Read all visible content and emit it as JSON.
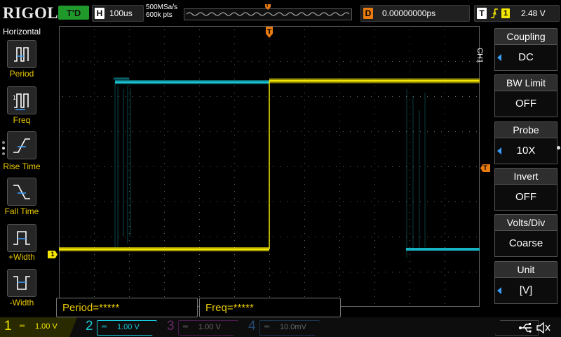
{
  "brand": {
    "logo": "RIGOL"
  },
  "top": {
    "status": "T'D",
    "timebase_tag": "H",
    "timebase": "100us",
    "sample_rate": "500MSa/s",
    "mem_depth": "600k pts",
    "trigger_pos_marker": "T",
    "delay_tag": "D",
    "delay": "0.00000000ps",
    "trigger_tag": "T",
    "trigger_channel": "1",
    "trigger_level": "2.48 V"
  },
  "left_menu": {
    "title": "Horizontal",
    "items": [
      {
        "label": "Period",
        "icon": "period-icon"
      },
      {
        "label": "Freq",
        "icon": "freq-icon"
      },
      {
        "label": "Rise Time",
        "icon": "rise-time-icon"
      },
      {
        "label": "Fall Time",
        "icon": "fall-time-icon"
      },
      {
        "label": "+Width",
        "icon": "pos-width-icon"
      },
      {
        "label": "-Width",
        "icon": "neg-width-icon"
      }
    ]
  },
  "right_menu": {
    "channel_tag": "CH1",
    "items": [
      {
        "title": "Coupling",
        "value": "DC",
        "arrow": true
      },
      {
        "title": "BW Limit",
        "value": "OFF",
        "arrow": false
      },
      {
        "title": "Probe",
        "value": "10X",
        "arrow": true
      },
      {
        "title": "Invert",
        "value": "OFF",
        "arrow": false
      },
      {
        "title": "Volts/Div",
        "value": "Coarse",
        "arrow": false
      },
      {
        "title": "Unit",
        "value": "[V]",
        "arrow": true
      }
    ]
  },
  "measurements": {
    "period": "Period=*****",
    "freq": "Freq=*****"
  },
  "markers": {
    "ch1_ground": "1",
    "trigger_level": "T"
  },
  "channels": [
    {
      "num": "1",
      "coupling": "═",
      "scale": "1.00 V",
      "color": "#f4e600",
      "active": true
    },
    {
      "num": "2",
      "coupling": "═",
      "scale": "1.00 V",
      "color": "#19c8d8",
      "active": false
    },
    {
      "num": "3",
      "coupling": "═",
      "scale": "1.00 V",
      "color": "#c02ac0",
      "active": false
    },
    {
      "num": "4",
      "coupling": "═",
      "scale": "10.0mV",
      "color": "#2a78e6",
      "active": false
    }
  ],
  "colors": {
    "ch1": "#f4e600",
    "ch2": "#19c8d8",
    "trigger": "#e87a10",
    "accent": "#3aa0ff"
  }
}
